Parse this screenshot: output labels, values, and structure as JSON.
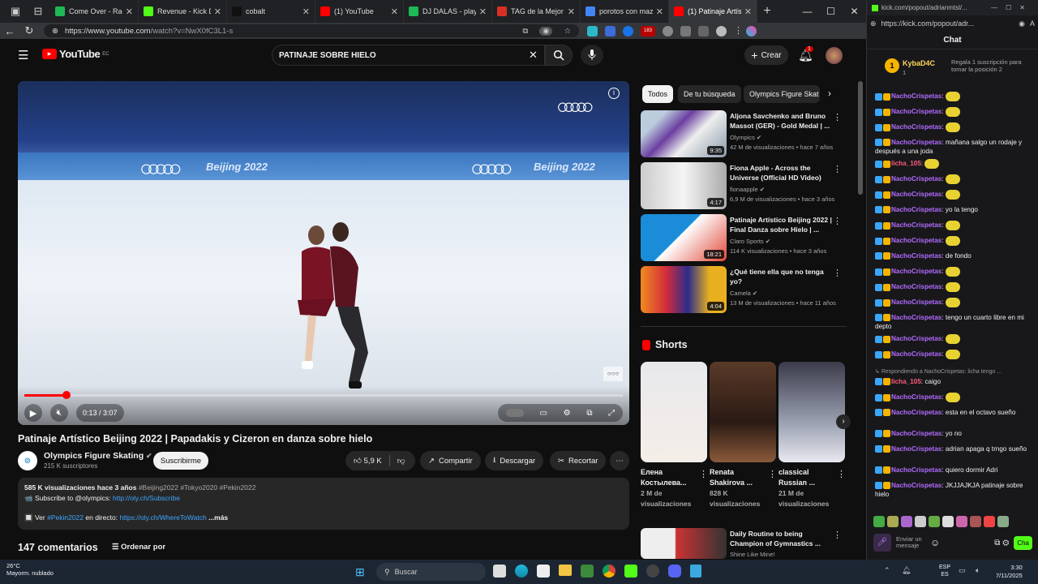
{
  "browser": {
    "tabs": [
      {
        "label": "Come Over - Radio V",
        "color": "#1db954"
      },
      {
        "label": "Revenue - Kick Dashb",
        "color": "#53fc18"
      },
      {
        "label": "cobalt",
        "color": "#111111"
      },
      {
        "label": "(1) YouTube",
        "color": "#ff0000"
      },
      {
        "label": "DJ DALAS - playlist b",
        "color": "#1db954"
      },
      {
        "label": "TAG de la Mejor Ami",
        "color": "#d93025"
      },
      {
        "label": "porotos con mazamo",
        "color": "#4285f4"
      },
      {
        "label": "(1) Patinaje Artístico",
        "color": "#ff0000"
      }
    ],
    "url_host": "https://www.youtube.com",
    "url_path": "/watch?v=NwX0fC3L1-s",
    "ext_badge": "183"
  },
  "youtube": {
    "logo": "YouTube",
    "logo_sup": "EC",
    "search_value": "PATINAJE SOBRE HIELO",
    "create_label": "Crear",
    "notif_count": "1"
  },
  "player": {
    "progress": 0.07,
    "time": "0:13 / 3:07",
    "board_text": "Beijing 2022"
  },
  "video": {
    "title": "Patinaje Artístico Beijing 2022 | Papadakis y Cizeron en danza sobre hielo",
    "channel": "Olympics Figure Skating",
    "subs": "215 K suscriptores",
    "subscribe": "Suscribirme",
    "likes": "5,9 K",
    "share": "Compartir",
    "download": "Descargar",
    "clip": "Recortar",
    "views_line": "585 K visualizaciones  hace 3 años",
    "hashtags": "#Beijing2022 #Tokyo2020 #Pekin2022",
    "desc_line2_prefix": "📹 Subscribe to @olympics:",
    "desc_link1": "http://oly.ch/Subscribe",
    "desc_line3_prefix": "🔲 Ver",
    "desc_tag": "#Pekin2022",
    "desc_mid": "en directo:",
    "desc_link2": "https://oly.ch/WhereToWatch",
    "more": "...más",
    "comments": "147 comentarios",
    "sort": "Ordenar por"
  },
  "chips": [
    "Todos",
    "De tu búsqueda",
    "Olympics Figure Skat"
  ],
  "recommendations": [
    {
      "title": "Aljona Savchenko and Bruno Massot (GER) - Gold Medal | ...",
      "channel": "Olympics",
      "meta": "42 M de visualizaciones • hace 7 años",
      "duration": "9:35"
    },
    {
      "title": "Fiona Apple - Across the Universe (Official HD Video)",
      "channel": "fionaapple",
      "meta": "6,9 M de visualizaciones • hace 3 años",
      "duration": "4:17"
    },
    {
      "title": "Patinaje Artístico Beijing 2022 | Final Danza sobre Hielo | ...",
      "channel": "Claro Sports",
      "meta": "114 K visualizaciones • hace 3 años",
      "duration": "18:21"
    },
    {
      "title": "¿Qué tiene ella que no tenga yo?",
      "channel": "Camela",
      "meta": "13 M de visualizaciones • hace 11 años",
      "duration": "4:04"
    }
  ],
  "shorts_header": "Shorts",
  "shorts": [
    {
      "title": "Елена Костылева...",
      "views": "2 M de visualizaciones"
    },
    {
      "title": "Renata Shakirova ...",
      "views": "828 K visualizaciones"
    },
    {
      "title": "classical Russian ...",
      "views": "21 M de visualizaciones"
    }
  ],
  "next_rec": {
    "title": "Daily Routine to being Champion of Gymnastics ...",
    "channel": "Shine Like Mine!"
  },
  "chat": {
    "url": "kick.com/popout/adrianmtsl/...",
    "url2": "https://kick.com/popout/adr...",
    "title": "Chat",
    "gift_user": "KybaD4C",
    "gift_count": "1",
    "gift_text": "Regala 1 suscripción para tomar la posición 2",
    "messages": [
      {
        "user": "NachoCrispetas",
        "text": ""
      },
      {
        "user": "NachoCrispetas",
        "text": ""
      },
      {
        "user": "NachoCrispetas",
        "text": ""
      },
      {
        "user": "NachoCrispetas",
        "text": "mañana salgo un rodaje y después a una joda"
      },
      {
        "user": "licha_105",
        "text": ""
      },
      {
        "user": "NachoCrispetas",
        "text": ""
      },
      {
        "user": "NachoCrispetas",
        "text": ""
      },
      {
        "user": "NachoCrispetas",
        "text": "yo la tengo"
      },
      {
        "user": "NachoCrispetas",
        "text": ""
      },
      {
        "user": "NachoCrispetas",
        "text": ""
      },
      {
        "user": "NachoCrispetas",
        "text": "de fondo"
      },
      {
        "user": "NachoCrispetas",
        "text": ""
      },
      {
        "user": "NachoCrispetas",
        "text": ""
      },
      {
        "user": "NachoCrispetas",
        "text": ""
      },
      {
        "user": "NachoCrispetas",
        "text": "tengo un cuarto libre en mi depto"
      },
      {
        "user": "NachoCrispetas",
        "text": ""
      },
      {
        "user": "NachoCrispetas",
        "text": ""
      }
    ],
    "reply_note": "Respondiendo a NachoCrispetas: licha tengo ...",
    "messages2": [
      {
        "user": "licha_105",
        "text": "caigo"
      },
      {
        "user": "NachoCrispetas",
        "text": ""
      },
      {
        "user": "NachoCrispetas",
        "text": "esta en el octavo sueño"
      },
      {
        "user": "NachoCrispetas",
        "text": "yo no"
      },
      {
        "user": "NachoCrispetas",
        "text": "adrian apaga q trngo sueño"
      },
      {
        "user": "NachoCrispetas",
        "text": "quiero dormir Adri"
      },
      {
        "user": "NachoCrispetas",
        "text": "JKJJAJKJA patinaje sobre hielo"
      }
    ],
    "input_placeholder": "Enviar un mensaje",
    "send": "Cha"
  },
  "taskbar": {
    "weather_temp": "26°C",
    "weather_desc": "Mayorm. nublado",
    "search": "Buscar",
    "lang1": "ESP",
    "lang2": "ES",
    "time": "3:30",
    "date": "7/11/2025"
  }
}
